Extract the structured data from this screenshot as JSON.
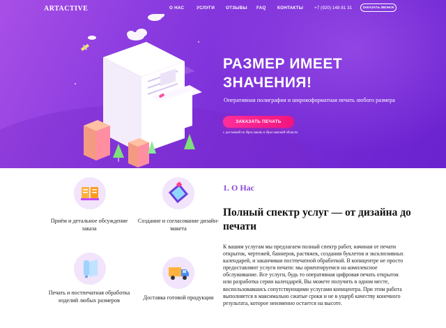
{
  "header": {
    "logo": "ARTACTIVE",
    "menu": [
      "О НАС",
      "УСЛУГИ",
      "ОТЗЫВЫ",
      "FAQ",
      "КОНТАКТЫ"
    ],
    "phone": "+7 (920) 148 81 31",
    "callback_label": "ЗАКАЗАТЬ ЗВОНОК"
  },
  "hero": {
    "title_line1": "РАЗМЕР ИМЕЕТ",
    "title_line2": "ЗНАЧЕНИЯ!",
    "subtitle": "Оперативная полиграфия и широкоформатная печать любого размера",
    "order_label": "ЗАКАЗАТЬ ПЕЧАТЬ",
    "delivery_note": "с доставкой по Ярославлю и Ярославской области"
  },
  "services": [
    {
      "label": "Приём и детальное обсуждение заказа",
      "icon": "book-icon"
    },
    {
      "label": "Создание и согласование дизайн-макета",
      "icon": "design-icon"
    },
    {
      "label": "Печать и постпечатная обработка изделий любых размеров",
      "icon": "paper-roll-icon"
    },
    {
      "label": "Доставка готовой продукции",
      "icon": "truck-icon"
    }
  ],
  "about": {
    "section_num": "1. О Нас",
    "title": "Полный спектр услуг — от дизайна до печати",
    "body": "К вашим услугам мы предлагаем полный спектр работ, начиная от печати открыток, чертежей, баннеров, растяжек, создания буклетов и эксклюзивных календарей, и заканчивая постпечатной обработкой. В копицентре не просто предоставляют услуги печати: мы ориентируемся на комплексное обслуживание. Все услуги, будь то оперативная цифровая печать открыток или разработка серии календарей, Вы можете получить в одном месте, воспользовавшись сопутствующими услугами копицентра. При этом работа выполняется в максимально сжатые сроки и не в ущерб качеству конечного результата, которое неизменно остается на высоте."
  },
  "colors": {
    "hero_purple": "#7a2fd8",
    "accent_pink": "#f1147e",
    "section_purple": "#8a46d8"
  }
}
